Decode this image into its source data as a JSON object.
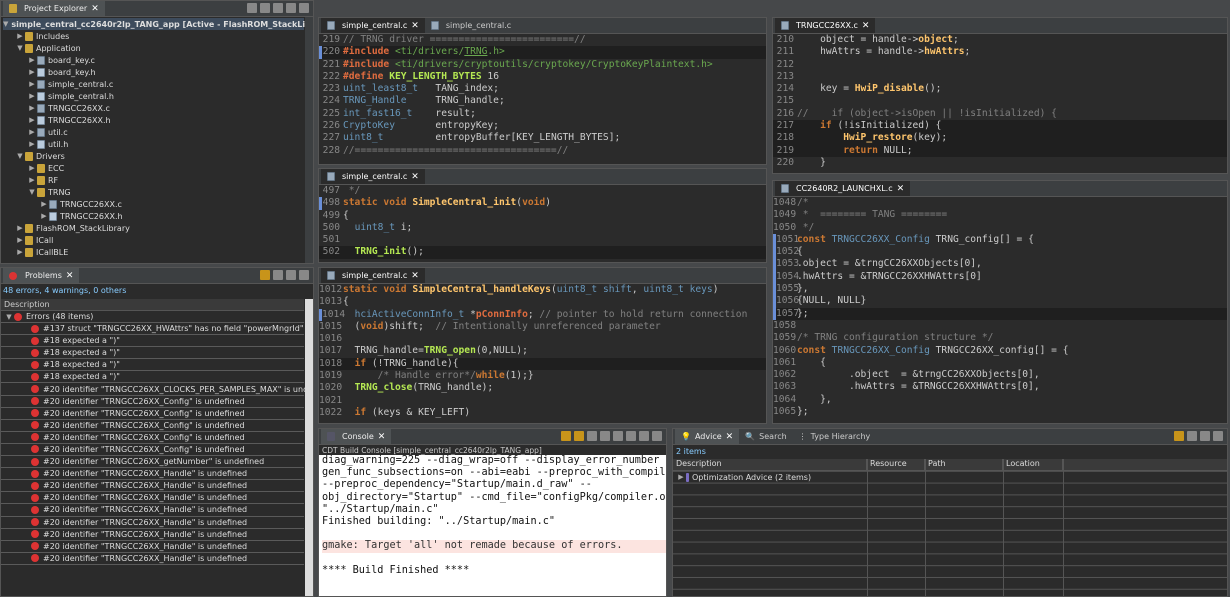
{
  "project_explorer": {
    "title": "Project Explorer",
    "items": [
      {
        "label": "simple_central_cc2640r2lp_TANG_app  [Active - FlashROM_StackLibrary]",
        "indent": 0,
        "twisty": "▼",
        "icon": "project-icon"
      },
      {
        "label": "Includes",
        "indent": 1,
        "twisty": "▶",
        "icon": "folder-icon"
      },
      {
        "label": "Application",
        "indent": 1,
        "twisty": "▼",
        "icon": "folder-icon"
      },
      {
        "label": "board_key.c",
        "indent": 2,
        "twisty": "▶",
        "icon": "c-file-icon"
      },
      {
        "label": "board_key.h",
        "indent": 2,
        "twisty": "▶",
        "icon": "h-file-icon"
      },
      {
        "label": "simple_central.c",
        "indent": 2,
        "twisty": "▶",
        "icon": "c-file-icon"
      },
      {
        "label": "simple_central.h",
        "indent": 2,
        "twisty": "▶",
        "icon": "h-file-icon"
      },
      {
        "label": "TRNGCC26XX.c",
        "indent": 2,
        "twisty": "▶",
        "icon": "c-file-icon"
      },
      {
        "label": "TRNGCC26XX.h",
        "indent": 2,
        "twisty": "▶",
        "icon": "h-file-icon"
      },
      {
        "label": "util.c",
        "indent": 2,
        "twisty": "▶",
        "icon": "c-file-icon"
      },
      {
        "label": "util.h",
        "indent": 2,
        "twisty": "▶",
        "icon": "h-file-icon"
      },
      {
        "label": "Drivers",
        "indent": 1,
        "twisty": "▼",
        "icon": "folder-icon"
      },
      {
        "label": "ECC",
        "indent": 2,
        "twisty": "▶",
        "icon": "folder-icon"
      },
      {
        "label": "RF",
        "indent": 2,
        "twisty": "▶",
        "icon": "folder-icon"
      },
      {
        "label": "TRNG",
        "indent": 2,
        "twisty": "▼",
        "icon": "folder-icon"
      },
      {
        "label": "TRNGCC26XX.c",
        "indent": 3,
        "twisty": "▶",
        "icon": "c-file-icon"
      },
      {
        "label": "TRNGCC26XX.h",
        "indent": 3,
        "twisty": "▶",
        "icon": "h-file-icon"
      },
      {
        "label": "FlashROM_StackLibrary",
        "indent": 1,
        "twisty": "▶",
        "icon": "folder-icon"
      },
      {
        "label": "ICall",
        "indent": 1,
        "twisty": "▶",
        "icon": "folder-icon"
      },
      {
        "label": "ICallBLE",
        "indent": 1,
        "twisty": "▶",
        "icon": "folder-icon"
      }
    ]
  },
  "problems": {
    "title": "Problems",
    "summary": "48 errors, 4 warnings, 0 others",
    "col": "Description",
    "group": "Errors (48 items)",
    "items": [
      "#137 struct \"TRNGCC26XX_HWAttrs\" has no field \"powerMngrId\"",
      "#18 expected a \")\"",
      "#18 expected a \")\"",
      "#18 expected a \")\"",
      "#18 expected a \")\"",
      "#20 identifier \"TRNGCC26XX_CLOCKS_PER_SAMPLES_MAX\" is undefined",
      "#20 identifier \"TRNGCC26XX_Config\" is undefined",
      "#20 identifier \"TRNGCC26XX_Config\" is undefined",
      "#20 identifier \"TRNGCC26XX_Config\" is undefined",
      "#20 identifier \"TRNGCC26XX_Config\" is undefined",
      "#20 identifier \"TRNGCC26XX_Config\" is undefined",
      "#20 identifier \"TRNGCC26XX_getNumber\" is undefined",
      "#20 identifier \"TRNGCC26XX_Handle\" is undefined",
      "#20 identifier \"TRNGCC26XX_Handle\" is undefined",
      "#20 identifier \"TRNGCC26XX_Handle\" is undefined",
      "#20 identifier \"TRNGCC26XX_Handle\" is undefined",
      "#20 identifier \"TRNGCC26XX_Handle\" is undefined",
      "#20 identifier \"TRNGCC26XX_Handle\" is undefined",
      "#20 identifier \"TRNGCC26XX_Handle\" is undefined",
      "#20 identifier \"TRNGCC26XX_Handle\" is undefined"
    ]
  },
  "editor1": {
    "tabs": [
      "simple_central.c",
      "simple_central.c"
    ]
  },
  "editor2": {
    "tabs": [
      "simple_central.c"
    ]
  },
  "editor3": {
    "tabs": [
      "simple_central.c"
    ]
  },
  "editor4": {
    "tabs": [
      "TRNGCC26XX.c"
    ]
  },
  "editor5": {
    "tabs": [
      "CC2640R2_LAUNCHXL.c"
    ]
  },
  "console": {
    "tabs": [
      "Console"
    ],
    "subtitle": "CDT Build Console [simple_central_cc2640r2lp_TANG_app]",
    "lines": [
      "diag_warning=225 --diag_wrap=off --display_error_number --",
      "gen_func_subsections=on --abi=eabi --preproc_with_compile",
      "--preproc_dependency=\"Startup/main.d_raw\" --",
      "obj_directory=\"Startup\" --cmd_file=\"configPkg/compiler.opt\"",
      "\"../Startup/main.c\"",
      "Finished building: \"../Startup/main.c\"",
      "",
      "gmake: Target 'all' not remade because of errors.",
      "",
      "**** Build Finished ****"
    ]
  },
  "advice": {
    "tabs": [
      "Advice",
      "Search",
      "Type Hierarchy"
    ],
    "count": "2 items",
    "columns": [
      "Description",
      "Resource",
      "Path",
      "Location"
    ],
    "row": "Optimization Advice (2 items)"
  }
}
